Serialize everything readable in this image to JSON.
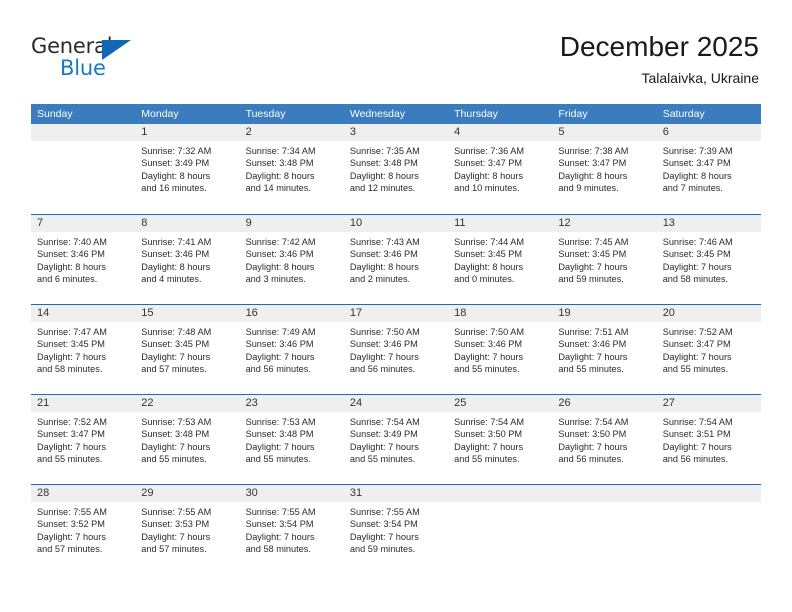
{
  "brand": {
    "name_part1": "General",
    "name_part2": "Blue",
    "triangle_icon": "triangle-icon",
    "accent_color": "#1b79c4",
    "header_color": "#3a7cbe"
  },
  "header": {
    "title": "December 2025",
    "subtitle": "Talalaivka, Ukraine"
  },
  "calendar": {
    "weekdays": [
      "Sunday",
      "Monday",
      "Tuesday",
      "Wednesday",
      "Thursday",
      "Friday",
      "Saturday"
    ],
    "weeks": [
      [
        {
          "day": "",
          "lines": []
        },
        {
          "day": "1",
          "lines": [
            "Sunrise: 7:32 AM",
            "Sunset: 3:49 PM",
            "Daylight: 8 hours",
            "and 16 minutes."
          ]
        },
        {
          "day": "2",
          "lines": [
            "Sunrise: 7:34 AM",
            "Sunset: 3:48 PM",
            "Daylight: 8 hours",
            "and 14 minutes."
          ]
        },
        {
          "day": "3",
          "lines": [
            "Sunrise: 7:35 AM",
            "Sunset: 3:48 PM",
            "Daylight: 8 hours",
            "and 12 minutes."
          ]
        },
        {
          "day": "4",
          "lines": [
            "Sunrise: 7:36 AM",
            "Sunset: 3:47 PM",
            "Daylight: 8 hours",
            "and 10 minutes."
          ]
        },
        {
          "day": "5",
          "lines": [
            "Sunrise: 7:38 AM",
            "Sunset: 3:47 PM",
            "Daylight: 8 hours",
            "and 9 minutes."
          ]
        },
        {
          "day": "6",
          "lines": [
            "Sunrise: 7:39 AM",
            "Sunset: 3:47 PM",
            "Daylight: 8 hours",
            "and 7 minutes."
          ]
        }
      ],
      [
        {
          "day": "7",
          "lines": [
            "Sunrise: 7:40 AM",
            "Sunset: 3:46 PM",
            "Daylight: 8 hours",
            "and 6 minutes."
          ]
        },
        {
          "day": "8",
          "lines": [
            "Sunrise: 7:41 AM",
            "Sunset: 3:46 PM",
            "Daylight: 8 hours",
            "and 4 minutes."
          ]
        },
        {
          "day": "9",
          "lines": [
            "Sunrise: 7:42 AM",
            "Sunset: 3:46 PM",
            "Daylight: 8 hours",
            "and 3 minutes."
          ]
        },
        {
          "day": "10",
          "lines": [
            "Sunrise: 7:43 AM",
            "Sunset: 3:46 PM",
            "Daylight: 8 hours",
            "and 2 minutes."
          ]
        },
        {
          "day": "11",
          "lines": [
            "Sunrise: 7:44 AM",
            "Sunset: 3:45 PM",
            "Daylight: 8 hours",
            "and 0 minutes."
          ]
        },
        {
          "day": "12",
          "lines": [
            "Sunrise: 7:45 AM",
            "Sunset: 3:45 PM",
            "Daylight: 7 hours",
            "and 59 minutes."
          ]
        },
        {
          "day": "13",
          "lines": [
            "Sunrise: 7:46 AM",
            "Sunset: 3:45 PM",
            "Daylight: 7 hours",
            "and 58 minutes."
          ]
        }
      ],
      [
        {
          "day": "14",
          "lines": [
            "Sunrise: 7:47 AM",
            "Sunset: 3:45 PM",
            "Daylight: 7 hours",
            "and 58 minutes."
          ]
        },
        {
          "day": "15",
          "lines": [
            "Sunrise: 7:48 AM",
            "Sunset: 3:45 PM",
            "Daylight: 7 hours",
            "and 57 minutes."
          ]
        },
        {
          "day": "16",
          "lines": [
            "Sunrise: 7:49 AM",
            "Sunset: 3:46 PM",
            "Daylight: 7 hours",
            "and 56 minutes."
          ]
        },
        {
          "day": "17",
          "lines": [
            "Sunrise: 7:50 AM",
            "Sunset: 3:46 PM",
            "Daylight: 7 hours",
            "and 56 minutes."
          ]
        },
        {
          "day": "18",
          "lines": [
            "Sunrise: 7:50 AM",
            "Sunset: 3:46 PM",
            "Daylight: 7 hours",
            "and 55 minutes."
          ]
        },
        {
          "day": "19",
          "lines": [
            "Sunrise: 7:51 AM",
            "Sunset: 3:46 PM",
            "Daylight: 7 hours",
            "and 55 minutes."
          ]
        },
        {
          "day": "20",
          "lines": [
            "Sunrise: 7:52 AM",
            "Sunset: 3:47 PM",
            "Daylight: 7 hours",
            "and 55 minutes."
          ]
        }
      ],
      [
        {
          "day": "21",
          "lines": [
            "Sunrise: 7:52 AM",
            "Sunset: 3:47 PM",
            "Daylight: 7 hours",
            "and 55 minutes."
          ]
        },
        {
          "day": "22",
          "lines": [
            "Sunrise: 7:53 AM",
            "Sunset: 3:48 PM",
            "Daylight: 7 hours",
            "and 55 minutes."
          ]
        },
        {
          "day": "23",
          "lines": [
            "Sunrise: 7:53 AM",
            "Sunset: 3:48 PM",
            "Daylight: 7 hours",
            "and 55 minutes."
          ]
        },
        {
          "day": "24",
          "lines": [
            "Sunrise: 7:54 AM",
            "Sunset: 3:49 PM",
            "Daylight: 7 hours",
            "and 55 minutes."
          ]
        },
        {
          "day": "25",
          "lines": [
            "Sunrise: 7:54 AM",
            "Sunset: 3:50 PM",
            "Daylight: 7 hours",
            "and 55 minutes."
          ]
        },
        {
          "day": "26",
          "lines": [
            "Sunrise: 7:54 AM",
            "Sunset: 3:50 PM",
            "Daylight: 7 hours",
            "and 56 minutes."
          ]
        },
        {
          "day": "27",
          "lines": [
            "Sunrise: 7:54 AM",
            "Sunset: 3:51 PM",
            "Daylight: 7 hours",
            "and 56 minutes."
          ]
        }
      ],
      [
        {
          "day": "28",
          "lines": [
            "Sunrise: 7:55 AM",
            "Sunset: 3:52 PM",
            "Daylight: 7 hours",
            "and 57 minutes."
          ]
        },
        {
          "day": "29",
          "lines": [
            "Sunrise: 7:55 AM",
            "Sunset: 3:53 PM",
            "Daylight: 7 hours",
            "and 57 minutes."
          ]
        },
        {
          "day": "30",
          "lines": [
            "Sunrise: 7:55 AM",
            "Sunset: 3:54 PM",
            "Daylight: 7 hours",
            "and 58 minutes."
          ]
        },
        {
          "day": "31",
          "lines": [
            "Sunrise: 7:55 AM",
            "Sunset: 3:54 PM",
            "Daylight: 7 hours",
            "and 59 minutes."
          ]
        },
        {
          "day": "",
          "lines": []
        },
        {
          "day": "",
          "lines": []
        },
        {
          "day": "",
          "lines": []
        }
      ]
    ]
  }
}
